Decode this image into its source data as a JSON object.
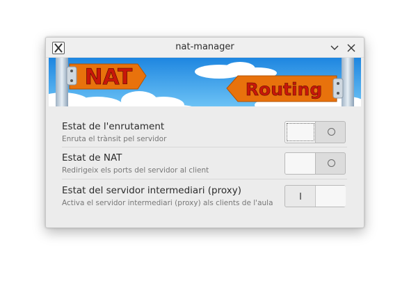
{
  "window": {
    "title": "nat-manager",
    "app_icon": "x-app-icon",
    "minimize_icon": "chevron-down-icon",
    "close_icon": "close-icon"
  },
  "banner": {
    "left_sign": "NAT",
    "right_sign": "Routing",
    "sky_color": "#2f9be8",
    "sign_color": "#e8720c",
    "text_color": "#c8170a"
  },
  "settings": [
    {
      "label": "Estat de l'enrutament",
      "description": "Enruta el trànsit pel servidor",
      "state": "off",
      "switch_symbol_on": "I",
      "switch_symbol_off": "O"
    },
    {
      "label": "Estat de NAT",
      "description": "Redirigeix els ports del servidor al client",
      "state": "off",
      "switch_symbol_on": "I",
      "switch_symbol_off": "O"
    },
    {
      "label": "Estat del servidor intermediari (proxy)",
      "description": "Activa el servidor intermediari (proxy) als clients de l'aula",
      "state": "on",
      "switch_symbol_on": "I",
      "switch_symbol_off": "O"
    }
  ]
}
